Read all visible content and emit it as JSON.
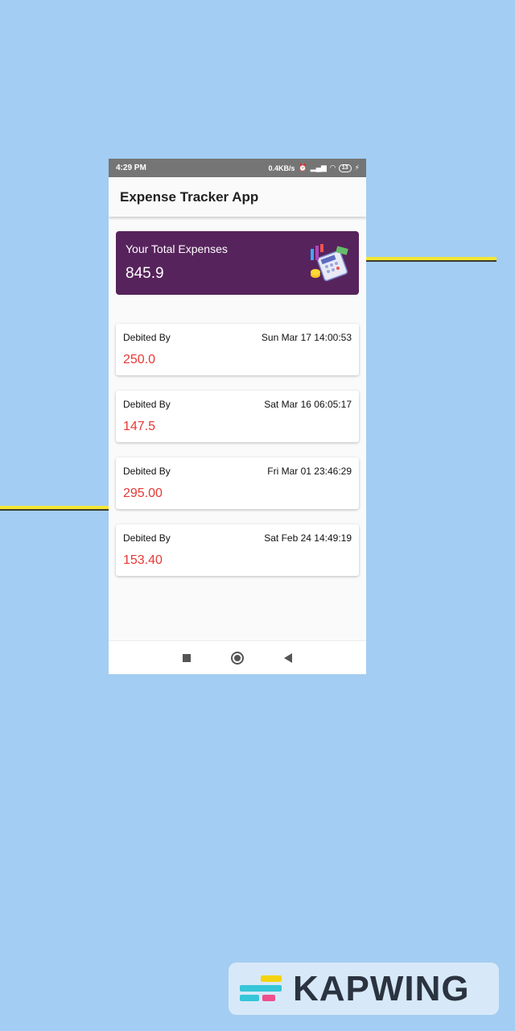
{
  "status_bar": {
    "time": "4:29 PM",
    "network_speed": "0.4KB/s",
    "battery": "13",
    "icons": [
      "alarm-icon",
      "volte-icon",
      "signal-icon",
      "wifi-icon",
      "battery-icon",
      "charging-icon"
    ]
  },
  "app_bar": {
    "title": "Expense Tracker App"
  },
  "total_card": {
    "label": "Your Total Expenses",
    "value": "845.9",
    "background": "#57235c",
    "icon": "calculator-finance-icon"
  },
  "transactions": [
    {
      "label": "Debited By",
      "datetime": "Sun Mar 17 14:00:53",
      "amount": "250.0"
    },
    {
      "label": "Debited By",
      "datetime": "Sat Mar 16 06:05:17",
      "amount": "147.5"
    },
    {
      "label": "Debited By",
      "datetime": "Fri Mar 01 23:46:29",
      "amount": "295.00"
    },
    {
      "label": "Debited By",
      "datetime": "Sat Feb 24 14:49:19",
      "amount": "153.40"
    }
  ],
  "colors": {
    "background": "#a3cdf2",
    "amount": "#e53935",
    "accent_line": "#f5e635"
  },
  "nav_bar": {
    "icons": [
      "recents-square-icon",
      "home-circle-icon",
      "back-triangle-icon"
    ]
  },
  "watermark": {
    "text": "KAPWING",
    "icon": "kapwing-logo-icon"
  }
}
